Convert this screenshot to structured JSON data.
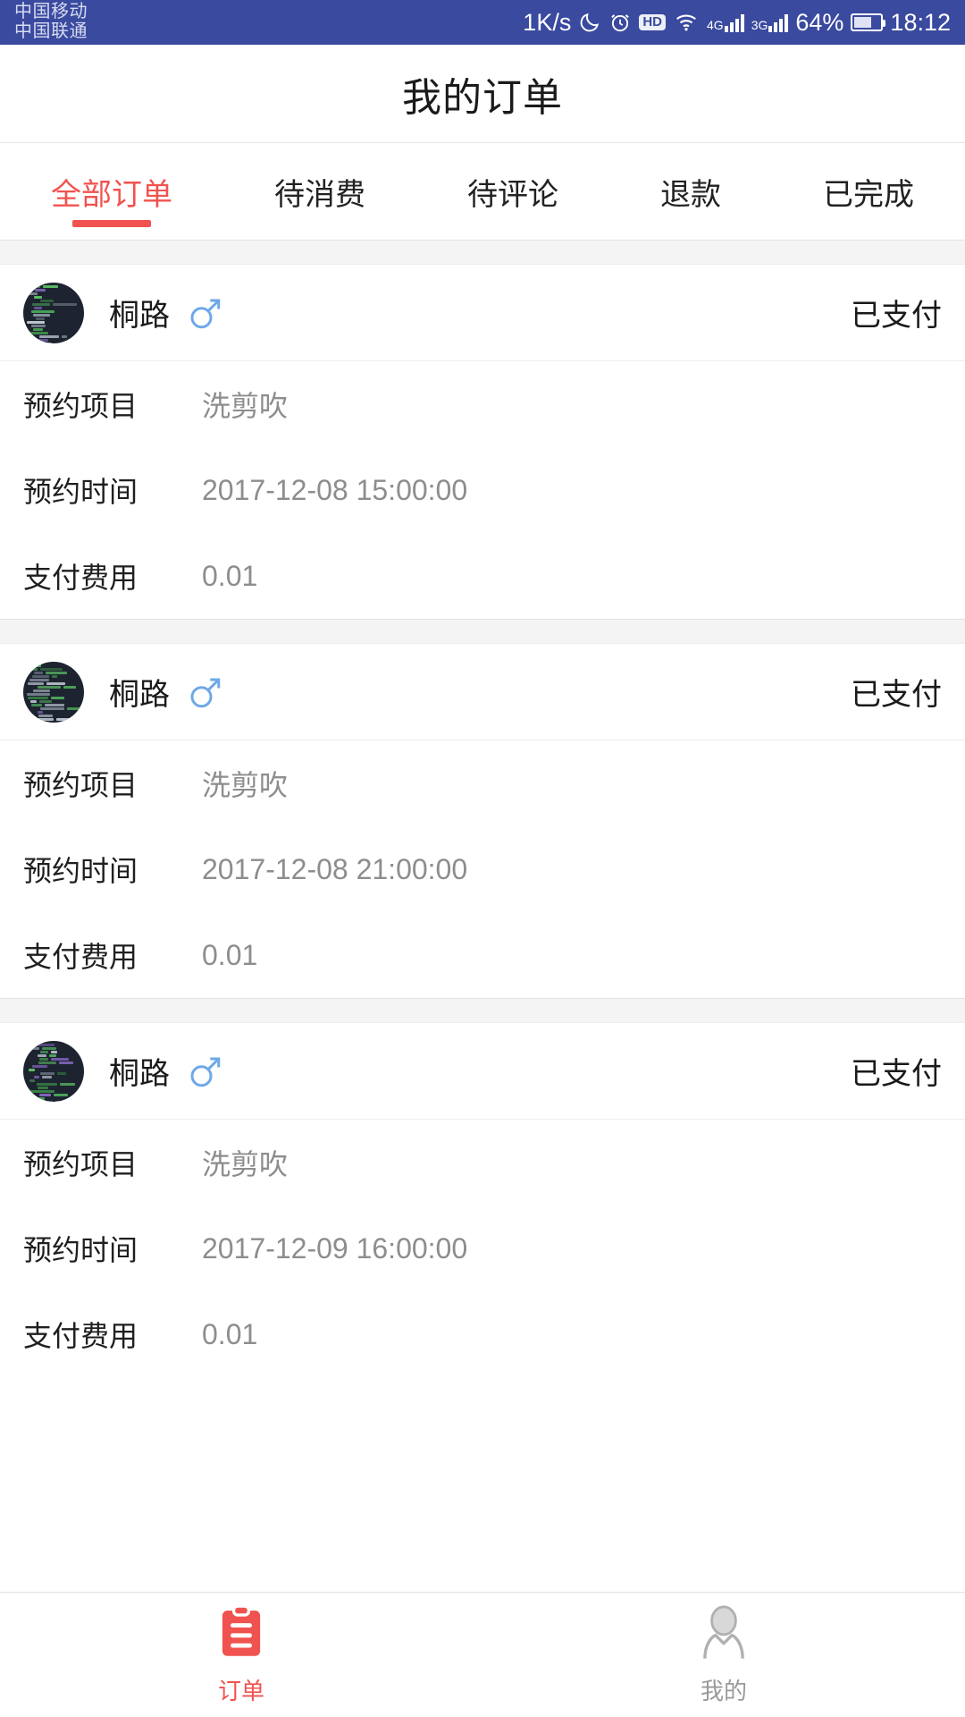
{
  "statusbar": {
    "carriers": [
      "中国移动",
      "中国联通"
    ],
    "net_speed": "1K/s",
    "icons": [
      "moon-icon",
      "alarm-icon",
      "hd-icon",
      "wifi-icon",
      "signal-4g-icon",
      "signal-3g-icon",
      "battery-icon"
    ],
    "hd_label": "HD",
    "net_label_1": "4G",
    "net_label_2": "3G",
    "battery": "64%",
    "time": "18:12"
  },
  "header": {
    "title": "我的订单"
  },
  "tabs": [
    {
      "label": "全部订单",
      "active": true
    },
    {
      "label": "待消费",
      "active": false
    },
    {
      "label": "待评论",
      "active": false
    },
    {
      "label": "退款",
      "active": false
    },
    {
      "label": "已完成",
      "active": false
    }
  ],
  "orders": [
    {
      "user": "桐路",
      "gender": "male",
      "status": "已支付",
      "rows": [
        {
          "label": "预约项目",
          "value": "洗剪吹"
        },
        {
          "label": "预约时间",
          "value": "2017-12-08 15:00:00"
        },
        {
          "label": "支付费用",
          "value": "0.01"
        }
      ]
    },
    {
      "user": "桐路",
      "gender": "male",
      "status": "已支付",
      "rows": [
        {
          "label": "预约项目",
          "value": "洗剪吹"
        },
        {
          "label": "预约时间",
          "value": "2017-12-08 21:00:00"
        },
        {
          "label": "支付费用",
          "value": "0.01"
        }
      ]
    },
    {
      "user": "桐路",
      "gender": "male",
      "status": "已支付",
      "rows": [
        {
          "label": "预约项目",
          "value": "洗剪吹"
        },
        {
          "label": "预约时间",
          "value": "2017-12-09 16:00:00"
        },
        {
          "label": "支付费用",
          "value": "0.01"
        }
      ]
    }
  ],
  "bottom_nav": [
    {
      "label": "订单",
      "icon": "clipboard-icon",
      "active": true
    },
    {
      "label": "我的",
      "icon": "person-icon",
      "active": false
    }
  ],
  "colors": {
    "status_bar_bg": "#3a4a9f",
    "accent": "#f0534f",
    "label_text": "#1f1f1f",
    "value_text": "#8d8d8d",
    "gender_blue": "#6ea8e8",
    "inactive_gray": "#9a9a9a"
  }
}
